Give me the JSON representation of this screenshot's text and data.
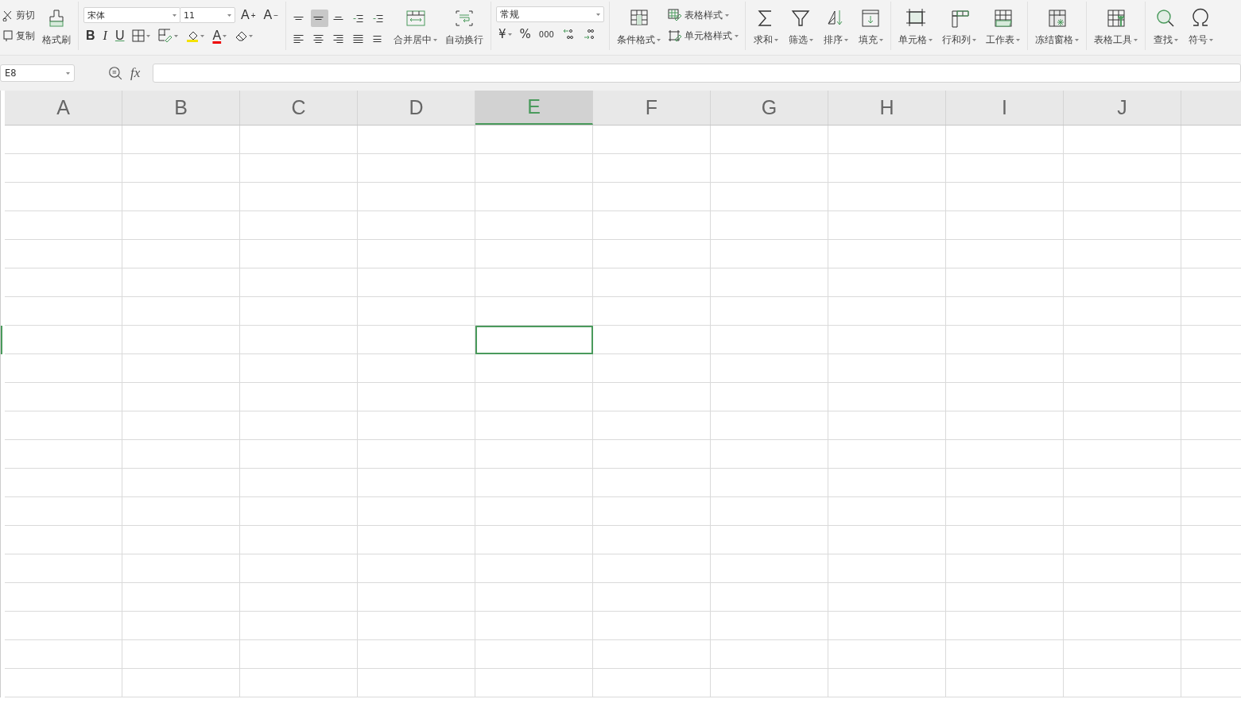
{
  "clipboard": {
    "small": [
      {
        "label": "剪切"
      },
      {
        "label": "复制"
      }
    ],
    "format_painter": {
      "label": "格式刷"
    }
  },
  "font": {
    "family": "宋体",
    "size": "11",
    "size_buttons": [
      {
        "glyph": "A",
        "sign": "+"
      },
      {
        "glyph": "A",
        "sign": "−"
      }
    ],
    "style_buttons": [
      "B",
      "I",
      "U"
    ],
    "color_glyph": "A"
  },
  "alignment": {
    "buttons": [
      {
        "selected": false
      },
      {
        "selected": true
      },
      {
        "selected": false
      },
      {
        "selected": false
      },
      {
        "selected": false
      },
      {
        "selected": false
      },
      {
        "selected": false
      },
      {
        "selected": false
      },
      {
        "selected": false
      },
      {
        "selected": false
      }
    ],
    "merge": {
      "label": "合并居中",
      "dropdown": true
    },
    "wrap": {
      "label": "自动换行",
      "dropdown": false
    }
  },
  "number": {
    "format": "常规",
    "buttons": [
      {
        "text": "¥",
        "dropdown": true
      },
      {
        "text": "%",
        "dropdown": false
      },
      {
        "text": "000",
        "dropdown": false
      }
    ]
  },
  "styles": {
    "conditional": {
      "label": "条件格式",
      "dropdown": true
    },
    "small": [
      {
        "label": "表格样式",
        "dropdown": true
      },
      {
        "label": "单元格样式",
        "dropdown": true
      }
    ]
  },
  "tool_groups": [
    [
      {
        "label": "求和",
        "dropdown": true
      },
      {
        "label": "筛选",
        "dropdown": true
      },
      {
        "label": "排序",
        "dropdown": true
      },
      {
        "label": "填充",
        "dropdown": true
      }
    ],
    [
      {
        "label": "单元格",
        "dropdown": true
      },
      {
        "label": "行和列",
        "dropdown": true
      },
      {
        "label": "工作表",
        "dropdown": true
      }
    ],
    [
      {
        "label": "冻结窗格",
        "dropdown": true
      }
    ],
    [
      {
        "label": "表格工具",
        "dropdown": true
      }
    ],
    [
      {
        "label": "查找",
        "dropdown": true
      },
      {
        "label": "符号",
        "dropdown": true
      }
    ]
  ],
  "formula_bar": {
    "name_box": "E8",
    "fx": "fx"
  },
  "sheet": {
    "columns": [
      {
        "label": "A",
        "selected": false
      },
      {
        "label": "B",
        "selected": false
      },
      {
        "label": "C",
        "selected": false
      },
      {
        "label": "D",
        "selected": false
      },
      {
        "label": "E",
        "selected": true
      },
      {
        "label": "F",
        "selected": false
      },
      {
        "label": "G",
        "selected": false
      },
      {
        "label": "H",
        "selected": false
      },
      {
        "label": "I",
        "selected": false
      },
      {
        "label": "J",
        "selected": false
      }
    ],
    "rows": [
      {
        "selected": false
      },
      {
        "selected": false
      },
      {
        "selected": false
      },
      {
        "selected": false
      },
      {
        "selected": false
      },
      {
        "selected": false
      },
      {
        "selected": false
      },
      {
        "selected": true
      },
      {
        "selected": false
      },
      {
        "selected": false
      },
      {
        "selected": false
      },
      {
        "selected": false
      },
      {
        "selected": false
      },
      {
        "selected": false
      },
      {
        "selected": false
      },
      {
        "selected": false
      },
      {
        "selected": false
      },
      {
        "selected": false
      },
      {
        "selected": false
      },
      {
        "selected": false
      }
    ]
  }
}
